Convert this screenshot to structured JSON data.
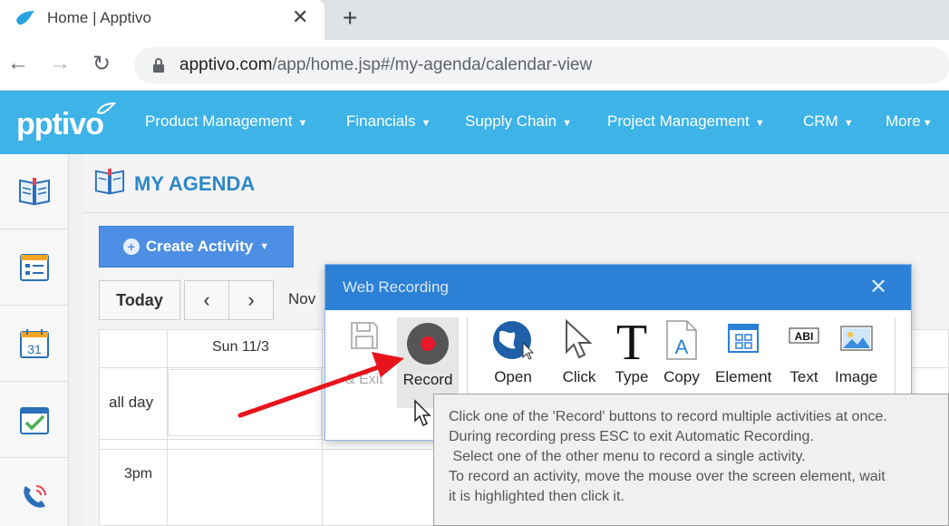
{
  "browser": {
    "tab_title": "Home | Apptivo",
    "url_host": "apptivo.com",
    "url_path": "/app/home.jsp#/my-agenda/calendar-view"
  },
  "header": {
    "logo": "pptivo",
    "menu": [
      "Product Management",
      "Financials",
      "Supply Chain",
      "Project Management",
      "CRM",
      "More"
    ]
  },
  "sidebar": {
    "items": [
      "book-icon",
      "form-icon",
      "calendar-icon",
      "checklist-icon",
      "phone-icon"
    ],
    "calendar_day": "31"
  },
  "page": {
    "title": "MY AGENDA",
    "create_label": "Create Activity",
    "today_label": "Today",
    "month_label": "Nov",
    "day_header": "Sun 11/3",
    "allday_label": "all day",
    "hour_label": "3pm"
  },
  "dialog": {
    "title": "Web Recording",
    "save_exit_label": "& Exit",
    "record_label": "Record",
    "tools": [
      "Open",
      "Click",
      "Type",
      "Copy",
      "Element",
      "Text",
      "Image"
    ],
    "text_tool_badge": "ABI"
  },
  "tooltip": {
    "lines": [
      "Click one of the 'Record' buttons to record multiple activities at once.",
      "During recording press ESC to exit Automatic Recording.",
      " Select one of the other menu to record a single activity.",
      "To record an activity, move the mouse over the screen element, wait",
      "it is highlighted then click it."
    ]
  },
  "colors": {
    "brand": "#3db3e8",
    "title_blue": "#2d88c9",
    "button_blue": "#4d8fe4",
    "dialog_blue": "#2c81d6",
    "record_red": "#e8192c"
  }
}
